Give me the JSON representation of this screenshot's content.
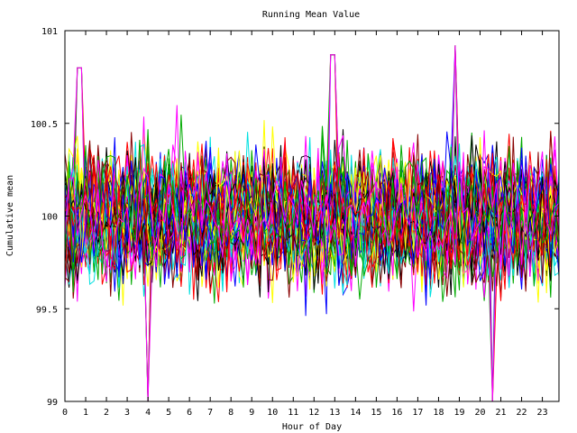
{
  "chart_data": {
    "type": "line",
    "title": "Running Mean Value",
    "xlabel": "Hour of Day",
    "ylabel": "Cumulative mean",
    "xlim": [
      0,
      23.8
    ],
    "ylim": [
      99,
      101
    ],
    "x_ticks": [
      0,
      1,
      2,
      3,
      4,
      5,
      6,
      7,
      8,
      9,
      10,
      11,
      12,
      13,
      14,
      15,
      16,
      17,
      18,
      19,
      20,
      21,
      22,
      23
    ],
    "x_tick_labels": [
      "0",
      "1",
      "2",
      "3",
      "4",
      "5",
      "6",
      "7",
      "8",
      "9",
      "10",
      "11",
      "12",
      "13",
      "14",
      "15",
      "16",
      "17",
      "18",
      "19",
      "20",
      "21",
      "22",
      "23"
    ],
    "y_ticks": [
      99,
      99.5,
      100,
      100.5,
      101
    ],
    "y_tick_labels": [
      "99",
      "99.5",
      "100",
      "100.5",
      "101"
    ],
    "grid": false,
    "legend": "none",
    "series_colors": [
      "#0000ff",
      "#ff0000",
      "#00aa00",
      "#ff00ff",
      "#00e0e0",
      "#ffff00",
      "#000000",
      "#880000"
    ],
    "series_count": 60,
    "points_per_series": 120,
    "mean": 100.0,
    "typical_range": [
      99.5,
      100.5
    ],
    "notable_extremes": [
      {
        "x": 4.0,
        "y": 99.0
      },
      {
        "x": 18.8,
        "y": 100.92
      },
      {
        "x": 12.9,
        "y": 100.87
      },
      {
        "x": 0.7,
        "y": 100.8
      },
      {
        "x": 20.6,
        "y": 99.0
      }
    ]
  }
}
